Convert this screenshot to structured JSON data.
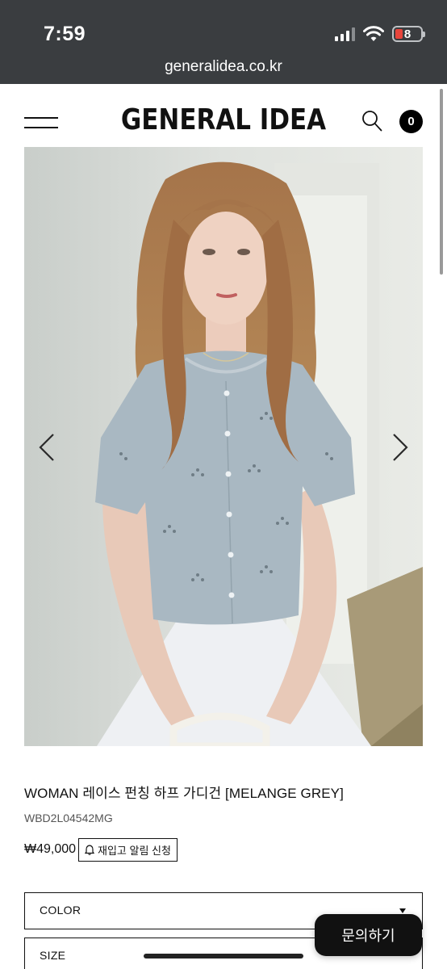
{
  "status_bar": {
    "time": "7:59",
    "battery_level": "8",
    "icons": [
      "cellular-signal-icon",
      "wifi-icon",
      "battery-icon"
    ]
  },
  "browser": {
    "url": "generalidea.co.kr"
  },
  "header": {
    "logo": "GENERAL IDEA",
    "cart_count": "0",
    "icons": [
      "hamburger-menu-icon",
      "search-icon"
    ]
  },
  "gallery": {
    "icons": [
      "chevron-left-icon",
      "chevron-right-icon"
    ]
  },
  "product": {
    "title": "WOMAN 레이스 펀칭 하프 가디건 [MELANGE GREY]",
    "code": "WBD2L04542MG",
    "price": "₩49,000",
    "restock_label": "재입고 알림 신청"
  },
  "options": {
    "color_label": "COLOR",
    "size_label": "SIZE"
  },
  "floating": {
    "inquiry_label": "문의하기"
  },
  "colors": {
    "chrome": "#3a3d40",
    "accent": "#111111",
    "battery_low": "#e8453c"
  }
}
